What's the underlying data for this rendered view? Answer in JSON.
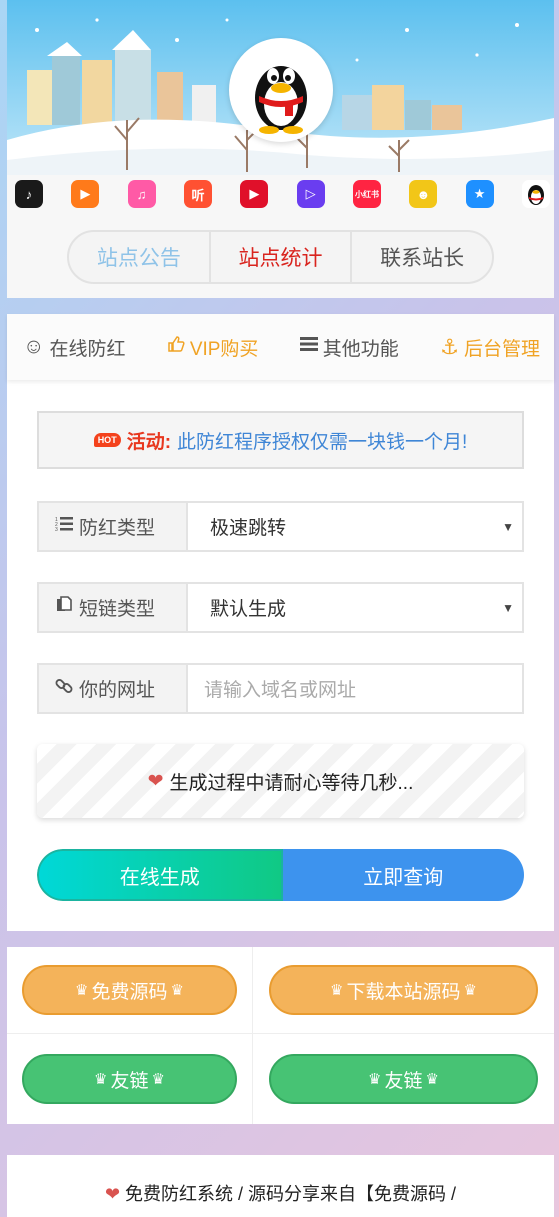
{
  "header": {
    "apps": [
      {
        "icon": "douyin-icon",
        "glyph": "♪",
        "bg": "#1a1a1a"
      },
      {
        "icon": "kuaishou-icon",
        "glyph": "▶",
        "bg": "#ff7a1a"
      },
      {
        "icon": "music-icon",
        "glyph": "♫",
        "bg": "#ff5aa6"
      },
      {
        "icon": "ting-icon",
        "glyph": "听",
        "bg": "#ff5132"
      },
      {
        "icon": "video-play-icon",
        "glyph": "▶",
        "bg": "#e0102a"
      },
      {
        "icon": "video-app-icon",
        "glyph": "▷",
        "bg": "#6a3df0"
      },
      {
        "icon": "xiaohongshu-icon",
        "glyph": "小红书",
        "bg": "#ff2442"
      },
      {
        "icon": "face-icon",
        "glyph": "☻",
        "bg": "#f2c618"
      },
      {
        "icon": "star-icon",
        "glyph": "★",
        "bg": "#1e90ff"
      },
      {
        "icon": "qq-penguin-icon",
        "glyph": "",
        "bg": "#ffffff"
      }
    ],
    "tabs": [
      {
        "label": "站点公告",
        "color": "#8fc3e8"
      },
      {
        "label": "站点统计",
        "color": "#d9241e"
      },
      {
        "label": "联系站长",
        "color": "#555555"
      }
    ]
  },
  "nav": {
    "online": "在线防红",
    "vip": "VIP购买",
    "other": "其他功能",
    "admin": "后台管理"
  },
  "notice": {
    "badge": "HOT",
    "label": "活动:",
    "text": "此防红程序授权仅需一块钱一个月!"
  },
  "form": {
    "type_label": "防红类型",
    "type_value": "极速跳转",
    "short_label": "短链类型",
    "short_value": "默认生成",
    "url_label": "你的网址",
    "url_placeholder": "请输入域名或网址"
  },
  "progress_text": "生成过程中请耐心等待几秒...",
  "actions": {
    "generate": "在线生成",
    "query": "立即查询"
  },
  "links": {
    "free_source": "免费源码",
    "download_source": "下载本站源码",
    "friend_link_1": "友链",
    "friend_link_2": "友链"
  },
  "footer": {
    "line1": "免费防红系统 / 源码分享来自【免费源码 /",
    "line2": ""
  },
  "colors": {
    "accent_orange": "#f0a325",
    "link_blue": "#3f86d6",
    "hot_red": "#f4421c"
  }
}
